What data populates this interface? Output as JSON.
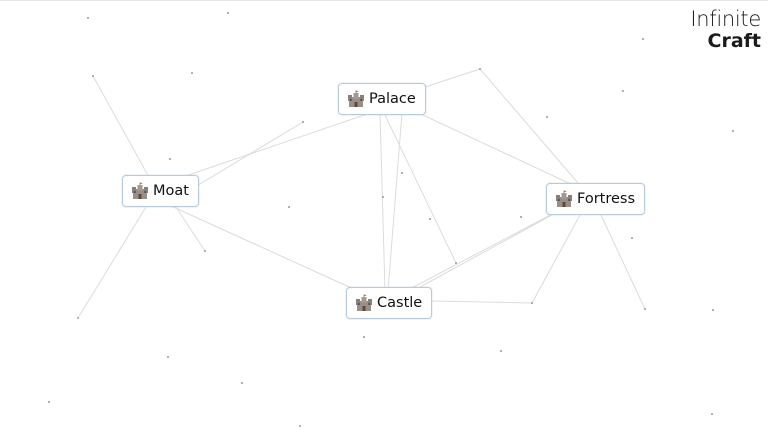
{
  "logo": {
    "line1": "Infinite",
    "line2": "Craft"
  },
  "items": [
    {
      "id": "palace",
      "label": "Palace",
      "icon": "castle-icon"
    },
    {
      "id": "moat",
      "label": "Moat",
      "icon": "castle-icon"
    },
    {
      "id": "fortress",
      "label": "Fortress",
      "icon": "castle-icon"
    },
    {
      "id": "castle",
      "label": "Castle",
      "icon": "castle-icon"
    }
  ],
  "colors": {
    "edge": "#d9d9d9",
    "node_border": "#b8cadd",
    "dot": "#8a8a8a",
    "castle_icon_main": "#9a8f86",
    "castle_icon_flag": "#d8504a"
  }
}
